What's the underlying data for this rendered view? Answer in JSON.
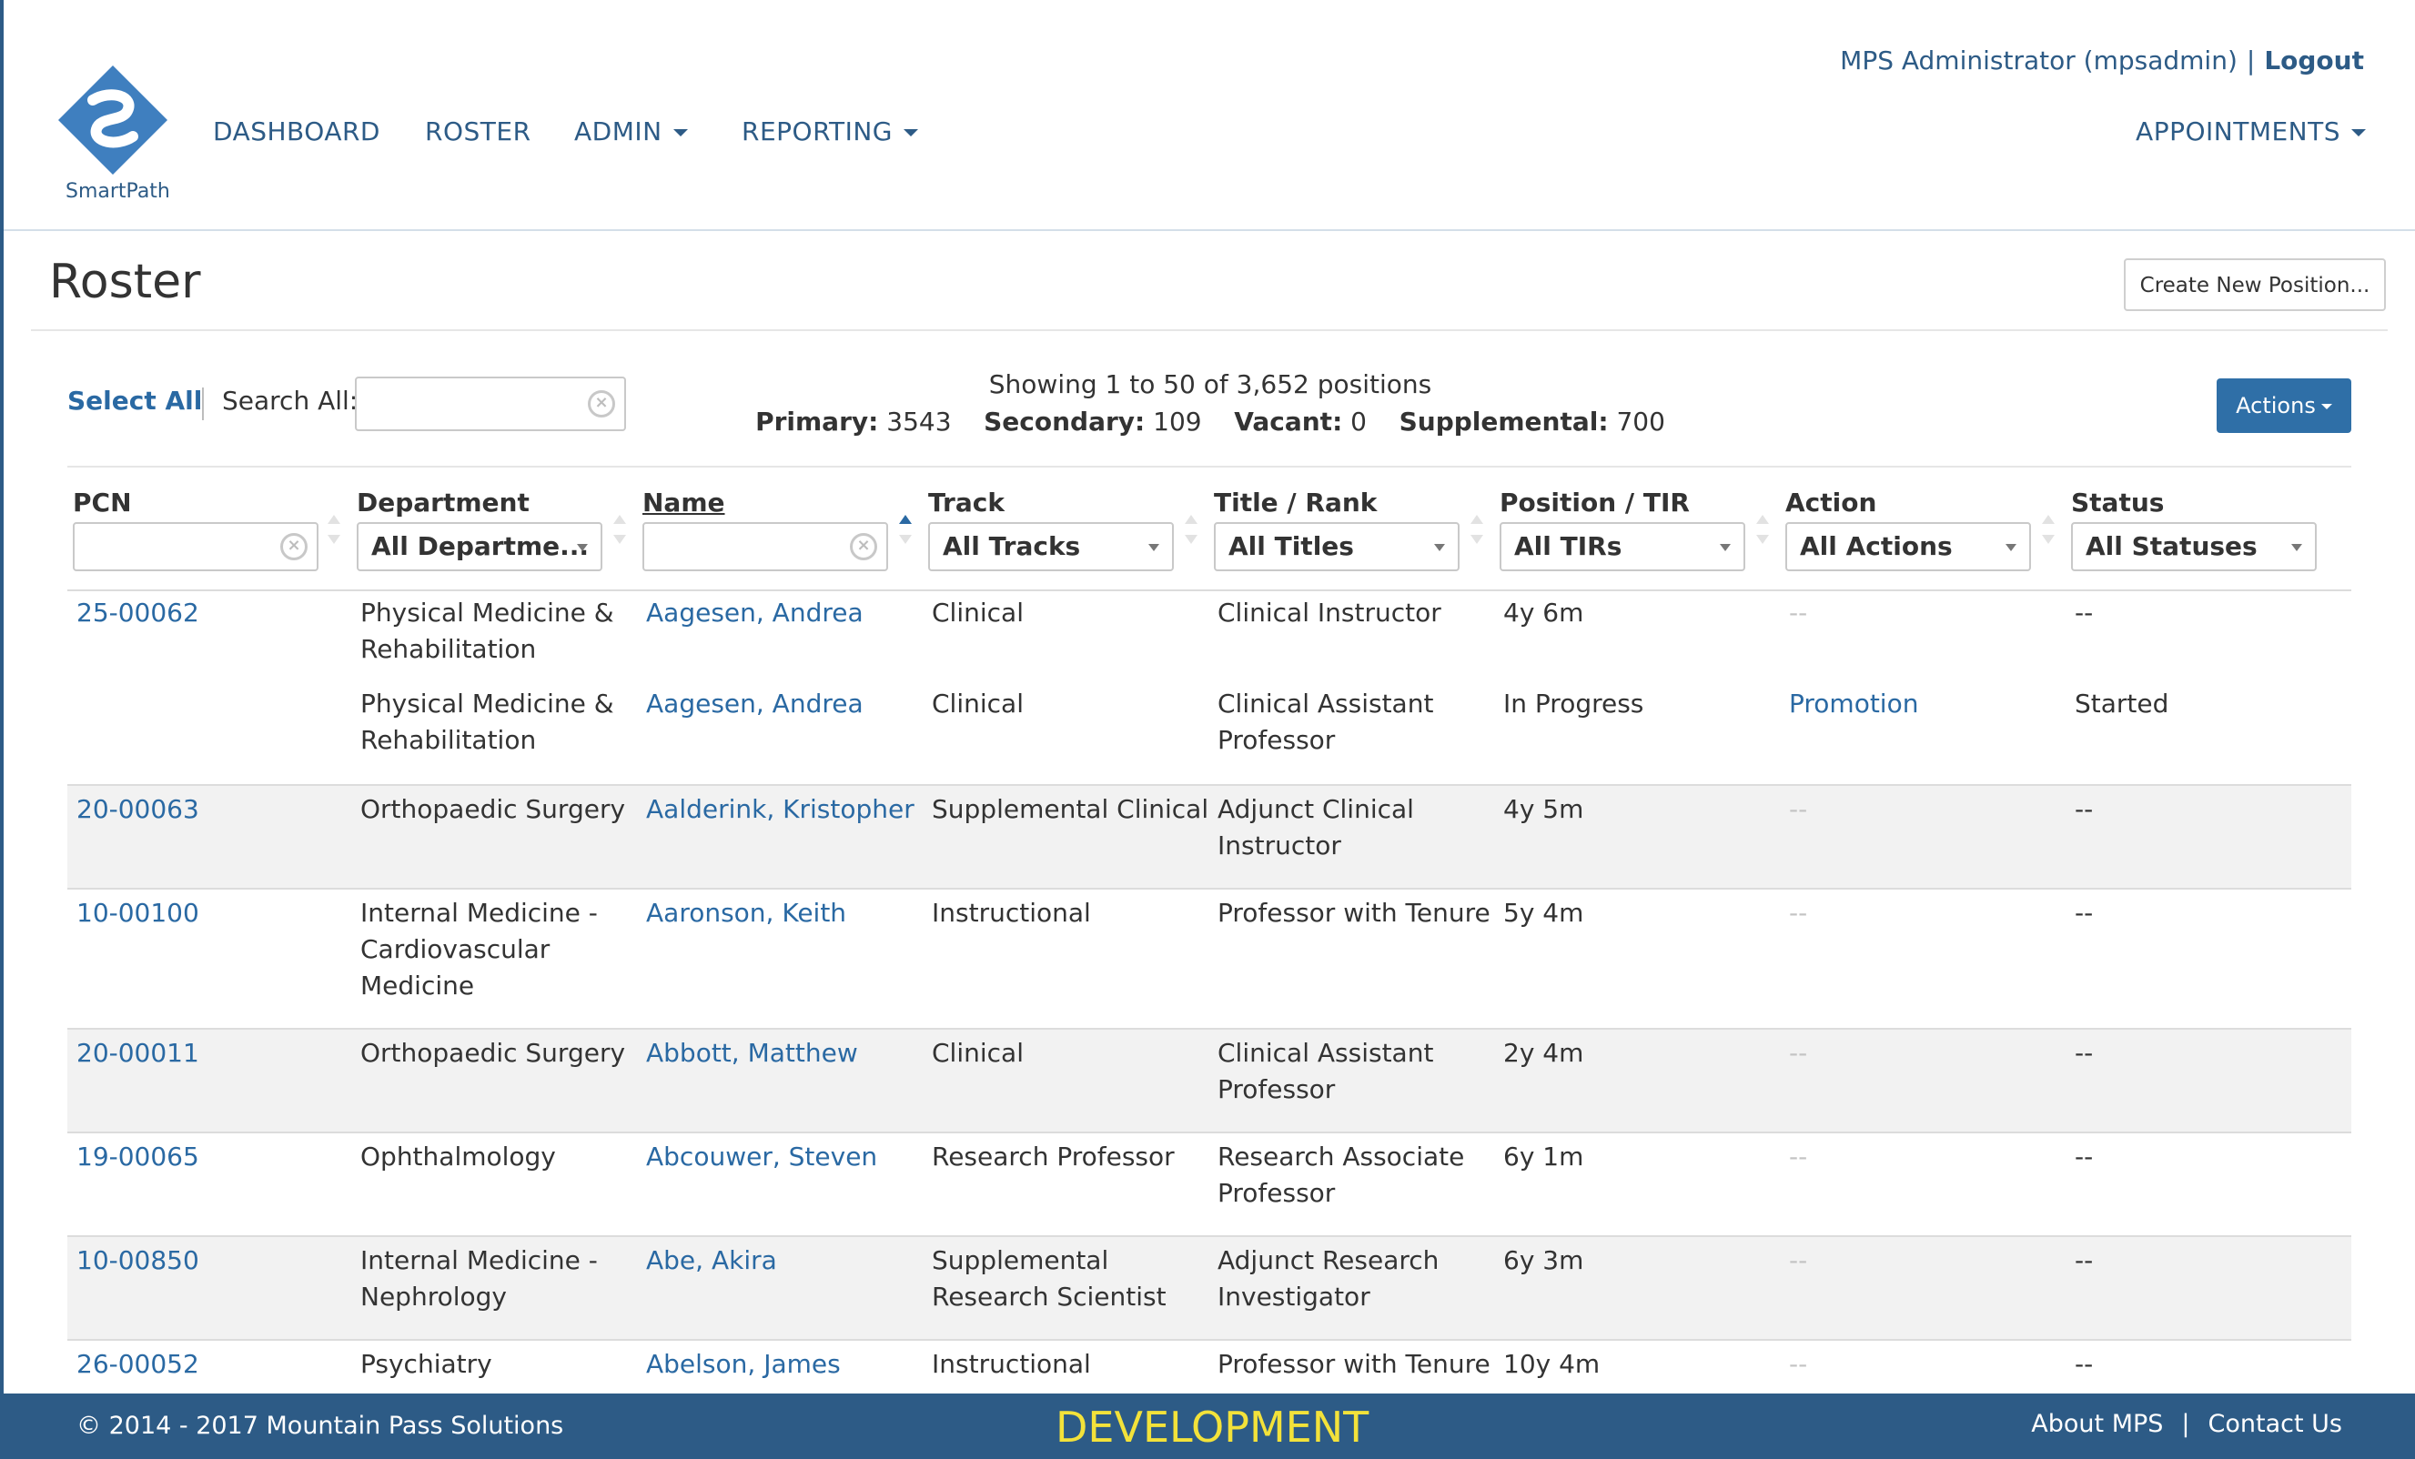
{
  "app": {
    "brand": "SmartPath",
    "nav": [
      {
        "label": "DASHBOARD",
        "dropdown": false
      },
      {
        "label": "ROSTER",
        "dropdown": false
      },
      {
        "label": "ADMIN",
        "dropdown": true
      },
      {
        "label": "REPORTING",
        "dropdown": true
      }
    ],
    "nav_right": {
      "label": "APPOINTMENTS",
      "dropdown": true
    },
    "user": {
      "name": "MPS Administrator (mpsadmin)",
      "separator": "|",
      "logout": "Logout"
    }
  },
  "page": {
    "title": "Roster",
    "create_button": "Create New Position..."
  },
  "toolbar": {
    "select_all": "Select All",
    "search_label": "Search All:",
    "search_value": "",
    "summary": {
      "line1": "Showing 1 to 50 of 3,652 positions",
      "primary_label": "Primary:",
      "primary": "3543",
      "secondary_label": "Secondary:",
      "secondary": "109",
      "vacant_label": "Vacant:",
      "vacant": "0",
      "supplemental_label": "Supplemental:",
      "supplemental": "700"
    },
    "actions_button": "Actions"
  },
  "table": {
    "columns": [
      {
        "label": "PCN",
        "filter": "",
        "filter_type": "text"
      },
      {
        "label": "Department",
        "filter": "All Departme...",
        "filter_type": "select"
      },
      {
        "label": "Name",
        "filter": "",
        "filter_type": "text",
        "sorted": "asc"
      },
      {
        "label": "Track",
        "filter": "All Tracks",
        "filter_type": "select"
      },
      {
        "label": "Title / Rank",
        "filter": "All Titles",
        "filter_type": "select"
      },
      {
        "label": "Position / TIR",
        "filter": "All TIRs",
        "filter_type": "select"
      },
      {
        "label": "Action",
        "filter": "All Actions",
        "filter_type": "select"
      },
      {
        "label": "Status",
        "filter": "All Statuses",
        "filter_type": "select"
      }
    ],
    "rows": [
      {
        "pcn": "25-00062",
        "dept1": "Physical Medicine &",
        "dept2": "Rehabilitation",
        "name": "Aagesen, Andrea",
        "track1": "Clinical",
        "track2": "",
        "title1": "Clinical Instructor",
        "title2": "",
        "tir": "4y 6m",
        "action": "--",
        "status": "--",
        "sub": {
          "dept1": "Physical Medicine &",
          "dept2": "Rehabilitation",
          "name": "Aagesen, Andrea",
          "track": "Clinical",
          "title1": "Clinical Assistant",
          "title2": "Professor",
          "tir": "In Progress",
          "action": "Promotion",
          "status": "Started"
        }
      },
      {
        "pcn": "20-00063",
        "dept1": "Orthopaedic Surgery",
        "dept2": "",
        "name": "Aalderink, Kristopher",
        "track1": "Supplemental Clinical",
        "track2": "",
        "title1": "Adjunct Clinical",
        "title2": "Instructor",
        "tir": "4y 5m",
        "action": "--",
        "status": "--"
      },
      {
        "pcn": "10-00100",
        "dept1": "Internal Medicine -",
        "dept2": "Cardiovascular",
        "dept3": "Medicine",
        "name": "Aaronson, Keith",
        "track1": "Instructional",
        "track2": "",
        "title1": "Professor with Tenure",
        "title2": "",
        "tir": "5y 4m",
        "action": "--",
        "status": "--"
      },
      {
        "pcn": "20-00011",
        "dept1": "Orthopaedic Surgery",
        "dept2": "",
        "name": "Abbott, Matthew",
        "track1": "Clinical",
        "track2": "",
        "title1": "Clinical Assistant",
        "title2": "Professor",
        "tir": "2y 4m",
        "action": "--",
        "status": "--"
      },
      {
        "pcn": "19-00065",
        "dept1": "Ophthalmology",
        "dept2": "",
        "name": "Abcouwer, Steven",
        "track1": "Research Professor",
        "track2": "",
        "title1": "Research Associate",
        "title2": "Professor",
        "tir": "6y 1m",
        "action": "--",
        "status": "--"
      },
      {
        "pcn": "10-00850",
        "dept1": "Internal Medicine -",
        "dept2": "Nephrology",
        "name": "Abe, Akira",
        "track1": "Supplemental",
        "track2": "Research Scientist",
        "title1": "Adjunct Research",
        "title2": "Investigator",
        "tir": "6y 3m",
        "action": "--",
        "status": "--"
      },
      {
        "pcn": "26-00052",
        "dept1": "Psychiatry",
        "dept2": "",
        "name": "Abelson, James",
        "track1": "Instructional",
        "track2": "",
        "title1": "Professor with Tenure",
        "title2": "",
        "tir": "10y 4m",
        "action": "--",
        "status": "--"
      }
    ]
  },
  "footer": {
    "copyright": "© 2014 - 2017 Mountain Pass Solutions",
    "environment": "DEVELOPMENT",
    "about": "About MPS",
    "separator": "|",
    "contact": "Contact Us"
  },
  "colors": {
    "brand": "#2d5b86",
    "link": "#2a69a3",
    "button_primary": "#2f6fa7",
    "env_label": "#f3e23a",
    "row_alt": "#f2f2f2"
  }
}
